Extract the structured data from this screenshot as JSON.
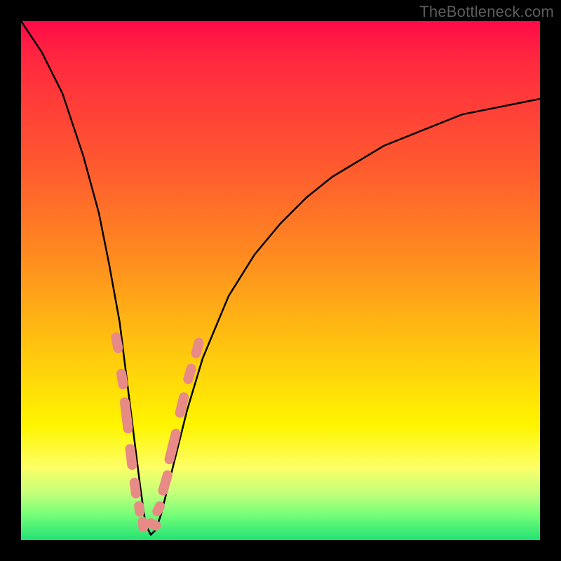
{
  "watermark": "TheBottleneck.com",
  "colors": {
    "frame": "#000000",
    "gradient_top": "#ff0b47",
    "gradient_mid1": "#ff8a20",
    "gradient_mid2": "#fff500",
    "gradient_bottom": "#22e273",
    "curve": "#000000",
    "beads": "#e88a85"
  },
  "chart_data": {
    "type": "line",
    "title": "",
    "xlabel": "",
    "ylabel": "",
    "xlim": [
      0,
      100
    ],
    "ylim": [
      0,
      100
    ],
    "note": "Abstract V-shaped bottleneck curve. Y ≈ 100 at edges, Y → 0 at the dip near x ≈ 24. No numeric axes in the image; values are read off proportionally (percent of plot width/height).",
    "x": [
      0,
      4,
      8,
      12,
      15,
      17,
      19,
      20,
      21,
      22,
      23,
      24,
      25,
      26,
      27,
      28,
      30,
      32,
      35,
      40,
      45,
      50,
      55,
      60,
      65,
      70,
      75,
      80,
      85,
      90,
      95,
      100
    ],
    "y_curve": [
      100,
      94,
      86,
      74,
      63,
      53,
      42,
      34,
      26,
      18,
      10,
      3,
      1,
      2,
      5,
      9,
      17,
      25,
      35,
      47,
      55,
      61,
      66,
      70,
      73,
      76,
      78,
      80,
      82,
      83,
      84,
      85
    ],
    "dip_x": 24,
    "beads_left": [
      {
        "x": 18.5,
        "y": 38,
        "len": 4
      },
      {
        "x": 19.5,
        "y": 31,
        "len": 4
      },
      {
        "x": 20.3,
        "y": 24,
        "len": 7
      },
      {
        "x": 21.2,
        "y": 16,
        "len": 5
      },
      {
        "x": 22.0,
        "y": 10,
        "len": 4
      },
      {
        "x": 22.8,
        "y": 6,
        "len": 3
      },
      {
        "x": 23.5,
        "y": 3,
        "len": 3
      }
    ],
    "beads_right": [
      {
        "x": 25.5,
        "y": 3,
        "len": 3
      },
      {
        "x": 26.5,
        "y": 6,
        "len": 3
      },
      {
        "x": 27.8,
        "y": 11,
        "len": 5
      },
      {
        "x": 29.2,
        "y": 18,
        "len": 7
      },
      {
        "x": 31.0,
        "y": 26,
        "len": 5
      },
      {
        "x": 32.5,
        "y": 32,
        "len": 4
      },
      {
        "x": 34.0,
        "y": 37,
        "len": 4
      }
    ]
  }
}
